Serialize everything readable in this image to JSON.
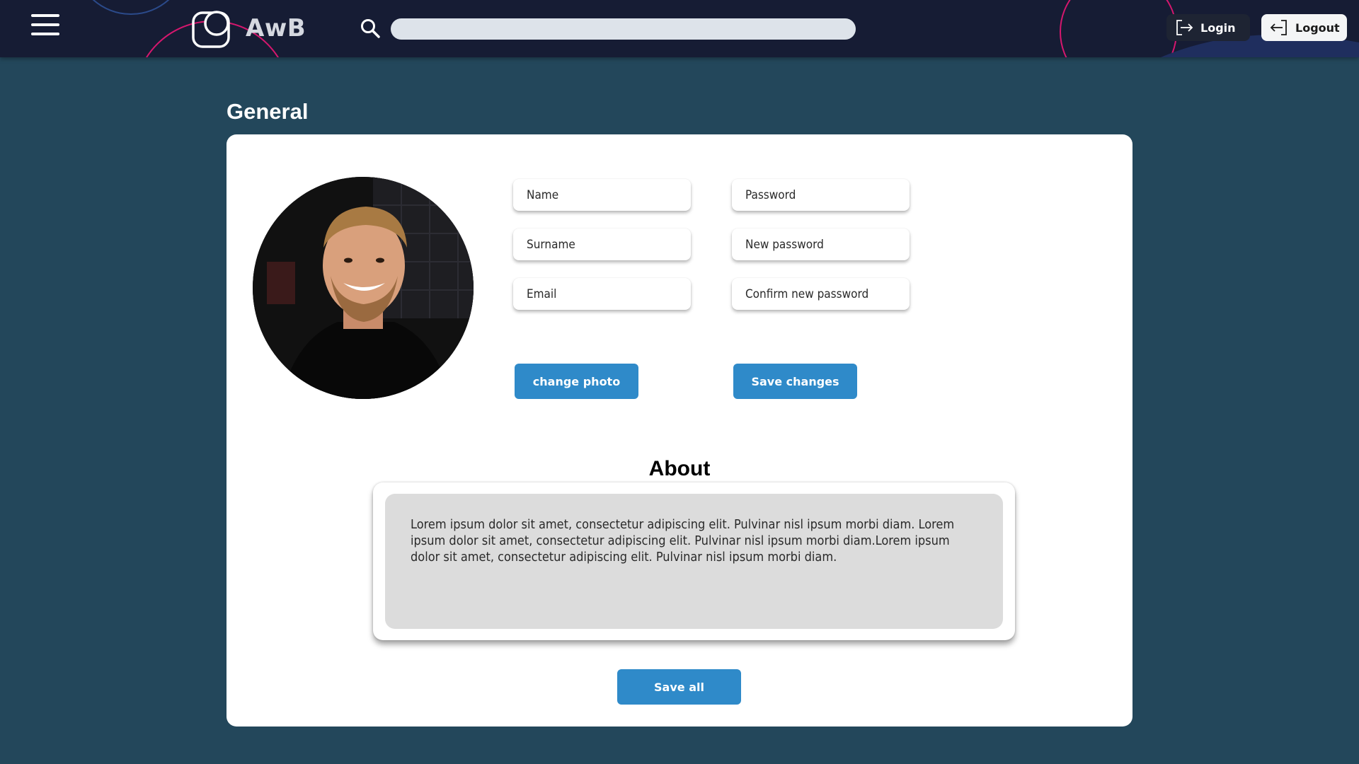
{
  "header": {
    "logo_text": "AwB",
    "search": {
      "value": "",
      "placeholder": ""
    },
    "login_label": "Login",
    "logout_label": "Logout"
  },
  "page": {
    "title": "General"
  },
  "form": {
    "name_placeholder": "Name",
    "surname_placeholder": "Surname",
    "email_placeholder": "Email",
    "password_placeholder": "Password",
    "new_password_placeholder": "New password",
    "confirm_password_placeholder": "Confirm new password",
    "change_photo_label": "change photo",
    "save_changes_label": "Save changes"
  },
  "about": {
    "title": "About",
    "text": "Lorem ipsum dolor sit amet, consectetur adipiscing elit. Pulvinar nisl ipsum morbi diam. Lorem ipsum dolor sit amet, consectetur adipiscing elit. Pulvinar nisl ipsum morbi diam.Lorem ipsum dolor sit amet, consectetur adipiscing elit. Pulvinar nisl ipsum morbi diam."
  },
  "save_all_label": "Save  all",
  "icons": {
    "menu": "hamburger-menu-icon",
    "logo": "logo-icon",
    "search": "search-icon",
    "login": "login-arrow-icon",
    "logout": "logout-arrow-icon"
  },
  "colors": {
    "header_bg": "#161c34",
    "page_bg": "#23475b",
    "accent_blue": "#2f8ac9",
    "decor_pink": "#d6176e",
    "decor_blue": "#2b4a8a"
  }
}
